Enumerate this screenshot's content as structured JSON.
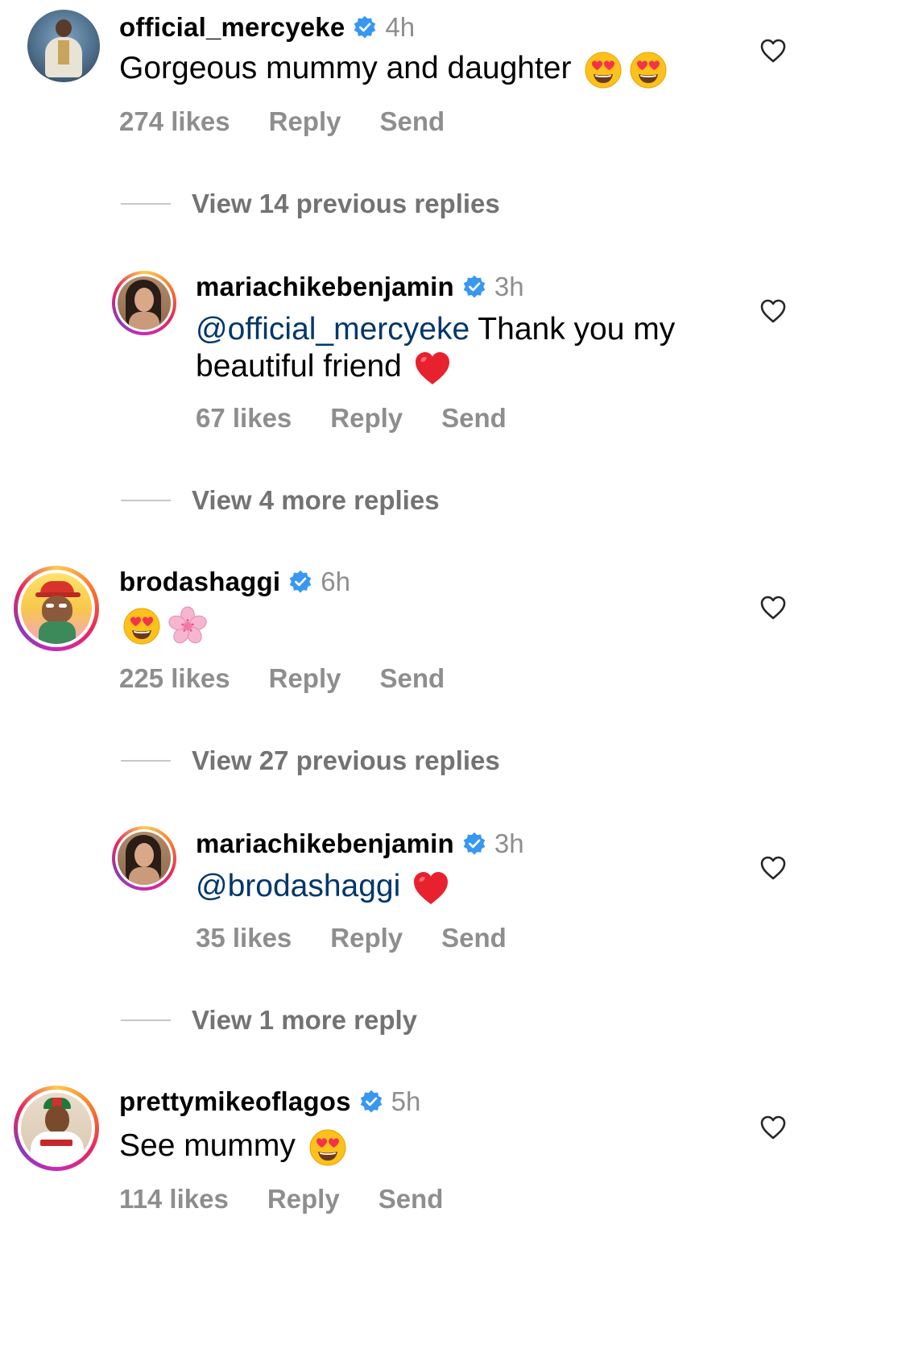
{
  "comments": [
    {
      "username": "official_mercyeke",
      "time": "4h",
      "text": "Gorgeous mummy and daughter",
      "likes": "274 likes",
      "reply_label": "Reply",
      "send_label": "Send"
    },
    {
      "username": "brodashaggi",
      "time": "6h",
      "text": "",
      "likes": "225 likes",
      "reply_label": "Reply",
      "send_label": "Send"
    },
    {
      "username": "prettymikeoflagos",
      "time": "5h",
      "text": "See mummy",
      "likes": "114 likes",
      "reply_label": "Reply",
      "send_label": "Send"
    }
  ],
  "replies": [
    {
      "username": "mariachikebenjamin",
      "time": "3h",
      "mention": "@official_mercyeke",
      "text_line1": " Thank you my",
      "text_line2": "beautiful friend",
      "likes": "67 likes",
      "reply_label": "Reply",
      "send_label": "Send"
    },
    {
      "username": "mariachikebenjamin",
      "time": "3h",
      "mention": "@brodashaggi",
      "likes": "35 likes",
      "reply_label": "Reply",
      "send_label": "Send"
    }
  ],
  "view_links": [
    "View 14 previous replies",
    "View 4 more replies",
    "View 27 previous replies",
    "View 1 more reply"
  ],
  "colors": {
    "verified": "#3897f0",
    "mention": "#00376b",
    "secondary": "#8e8e8e",
    "heart_red": "#e0245e"
  },
  "icons": {
    "verified": "verified-badge-icon",
    "heart": "heart-outline-icon",
    "emoji_heart_eyes": "heart-eyes-emoji",
    "emoji_red_heart": "red-heart-emoji",
    "emoji_cherry_blossom": "cherry-blossom-emoji"
  }
}
